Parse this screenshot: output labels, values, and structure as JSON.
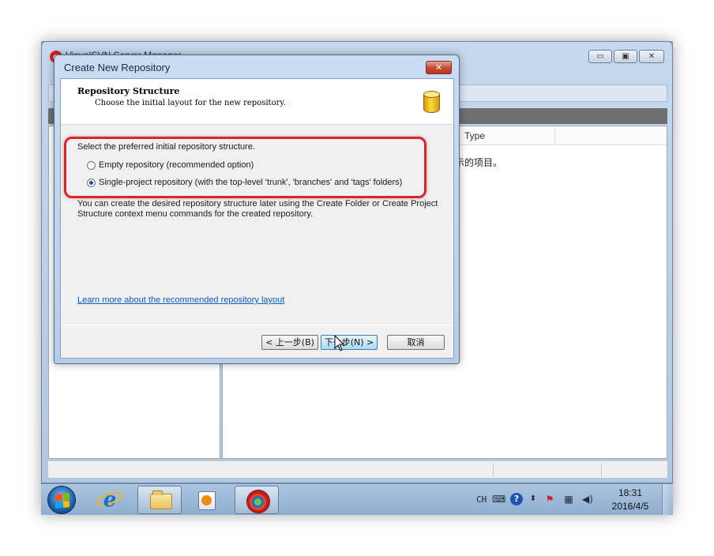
{
  "main_window": {
    "title": "VisualSVN Server Manager",
    "controls": [
      "▭",
      "▣",
      "✕"
    ],
    "column_type": "Type",
    "empty_message": "示的项目。"
  },
  "dialog": {
    "title": "Create New Repository",
    "close_glyph": "✕",
    "header": {
      "title": "Repository Structure",
      "subtitle": "Choose the initial layout for the new repository.",
      "icon": "database-icon"
    },
    "section_label": "Select the preferred initial repository structure.",
    "options": [
      {
        "label": "Empty repository (recommended option)",
        "selected": false
      },
      {
        "label": "Single-project repository (with the top-level 'trunk', 'branches' and 'tags' folders)",
        "selected": true
      }
    ],
    "hint": "You can create the desired repository structure later using the Create Folder or Create Project Structure context menu commands for the created repository.",
    "learn_more_link": "Learn more about the recommended repository layout",
    "buttons": {
      "back": "< 上一步(B)",
      "next": "下一步(N) >",
      "cancel": "取消"
    }
  },
  "taskbar": {
    "apps": [
      "windows-start-icon",
      "internet-explorer-icon",
      "file-explorer-icon",
      "media-player-icon",
      "visualsvn-icon"
    ],
    "tray": {
      "language": "CH",
      "icons": [
        "keyboard-icon",
        "help-icon",
        "ime-settings-icon",
        "action-center-flag-icon",
        "network-icon",
        "volume-icon"
      ],
      "time": "18:31",
      "date": "2016/4/5"
    }
  },
  "colors": {
    "highlight": "#d7262e",
    "link": "#0b5bc2",
    "title_bar": "#c9dcf2",
    "taskbar": "#9fbbd9"
  }
}
